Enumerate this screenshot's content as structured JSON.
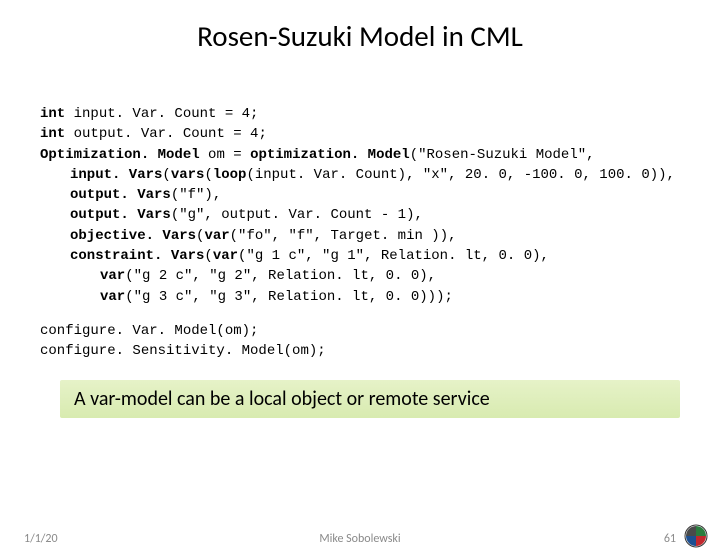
{
  "title": "Rosen-Suzuki Model in CML",
  "code": {
    "l1a": "int",
    "l1b": " input. Var. Count = 4;",
    "l2a": "int",
    "l2b": " output. Var. Count = 4;",
    "l3a": "Optimization. Model",
    "l3b": " om = ",
    "l3c": "optimization. Model",
    "l3d": "(\"Rosen-Suzuki Model\",",
    "l4a": "input. Vars",
    "l4b": "(",
    "l4c": "vars",
    "l4d": "(",
    "l4e": "loop",
    "l4f": "(input. Var. Count), \"x\", 20. 0, -100. 0, 100. 0)),",
    "l5a": "output. Vars",
    "l5b": "(\"f\"),",
    "l6a": "output. Vars",
    "l6b": "(\"g\", output. Var. Count - 1),",
    "l7a": "objective. Vars",
    "l7b": "(",
    "l7c": "var",
    "l7d": "(\"fo\", \"f\", Target. min )),",
    "l8a": "constraint. Vars",
    "l8b": "(",
    "l8c": "var",
    "l8d": "(\"g 1 c\", \"g 1\", Relation. lt, 0. 0),",
    "l9a": "var",
    "l9b": "(\"g 2 c\", \"g 2\", Relation. lt, 0. 0),",
    "l10a": "var",
    "l10b": "(\"g 3 c\", \"g 3\", Relation. lt, 0. 0)));",
    "l11": "configure. Var. Model(om);",
    "l12": "configure. Sensitivity. Model(om);"
  },
  "highlight": "A var-model can be a local object or remote service",
  "footer": {
    "date": "1/1/20",
    "author": "Mike Sobolewski",
    "page": "61"
  }
}
